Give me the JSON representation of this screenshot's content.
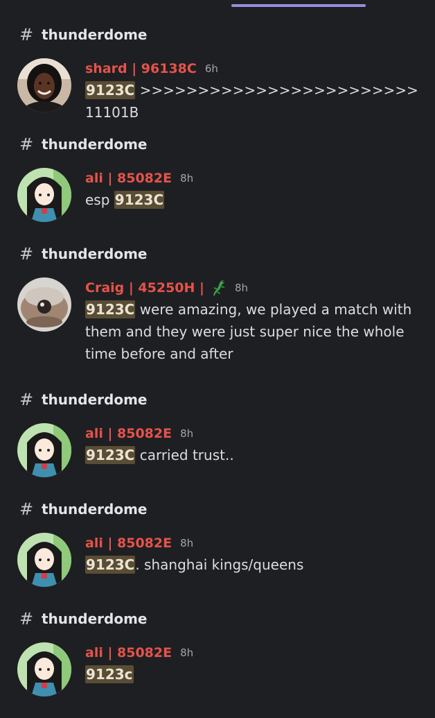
{
  "results": [
    {
      "channel": "thunderdome",
      "author": "shard | 96138C",
      "time": "6h",
      "highlight": "9123C",
      "text": " >>>>>>>>>>>>>>>>>>>>>>>> 11101B",
      "avatar": "avatar-shard"
    },
    {
      "channel": "thunderdome",
      "author": "ali | 85082E",
      "time": "8h",
      "pre": "esp ",
      "highlight": "9123C",
      "text": "",
      "avatar": "avatar-ali"
    },
    {
      "channel": "thunderdome",
      "author": "Craig | 45250H |",
      "emoji": "lizard-emoji-icon",
      "time": "8h",
      "highlight": "9123C",
      "text": " were amazing, we played a match with them and they were just super nice the whole time before and after",
      "avatar": "avatar-craig"
    },
    {
      "channel": "thunderdome",
      "author": "ali | 85082E",
      "time": "8h",
      "highlight": "9123C",
      "text": " carried trust..",
      "avatar": "avatar-ali"
    },
    {
      "channel": "thunderdome",
      "author": "ali | 85082E",
      "time": "8h",
      "highlight": "9123C",
      "text": ". shanghai kings/queens",
      "avatar": "avatar-ali"
    },
    {
      "channel": "thunderdome",
      "author": "ali | 85082E",
      "time": "8h",
      "highlight": "9123c",
      "text": "",
      "avatar": "avatar-ali"
    }
  ],
  "colors": {
    "background": "#1e1f22",
    "author": "#e5534b",
    "highlight_bg": "#5a4d35",
    "tab_indicator": "#9b8cdc"
  }
}
